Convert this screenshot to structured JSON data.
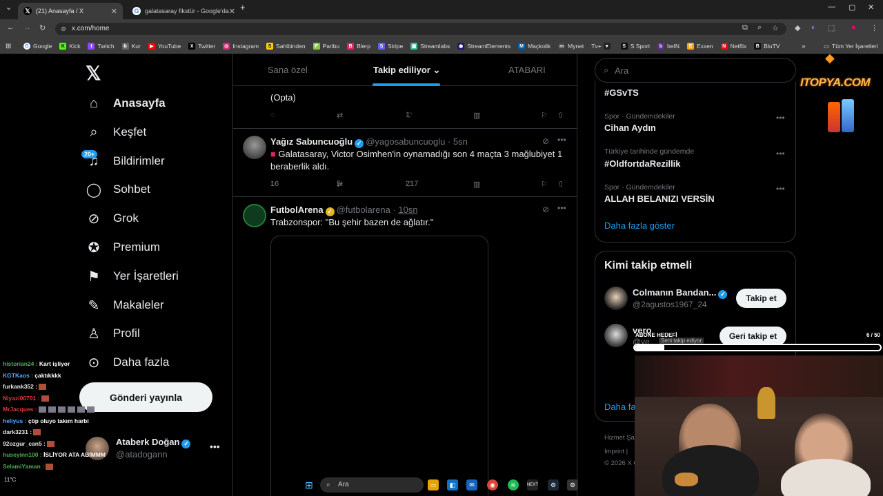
{
  "browser": {
    "tabs": [
      {
        "label": "(21) Anasayfa / X",
        "active": true
      },
      {
        "label": "galatasaray fikstür - Google'da",
        "active": false
      }
    ],
    "url": "x.com/home",
    "bookmarks": [
      "Google",
      "Kick",
      "Twitch",
      "Kur",
      "YouTube",
      "Twitter",
      "Instagram",
      "Sahibinden",
      "Paribu",
      "Blerp",
      "Stripe",
      "Streamlabs",
      "StreamElements",
      "Maçkolik",
      "Mynet",
      "Tv+",
      "S Sport",
      "beIN",
      "Exxen",
      "Netflix",
      "BluTV"
    ],
    "all_bookmarks": "Tüm Yer İşaretleri"
  },
  "nav": {
    "home": "Anasayfa",
    "explore": "Keşfet",
    "notifications": "Bildirimler",
    "notifications_badge": "20+",
    "messages": "Sohbet",
    "grok": "Grok",
    "premium": "Premium",
    "bookmarks": "Yer İşaretleri",
    "articles": "Makaleler",
    "profile": "Profil",
    "more": "Daha fazla",
    "post_button": "Gönderi yayınla"
  },
  "account": {
    "name": "Ataberk Doğan",
    "handle": "@atadogann"
  },
  "feed": {
    "tabs": [
      "Sana özel",
      "Takip ediliyor",
      "ATABARI"
    ],
    "partial_tweet": {
      "text": "(Opta)",
      "likes": "1"
    },
    "tweets": [
      {
        "name": "Yağız Sabuncuoğlu",
        "handle": "@yagosabuncuoglu",
        "time": "5sn",
        "text_line1": "Galatasaray, Victor Osimhen'in oynamadığı son 4 maçta 3 mağlubiyet 1",
        "text_line2": "beraberlik aldı.",
        "replies": "16",
        "retweets": "5",
        "likes": "217"
      },
      {
        "name": "FutbolArena",
        "handle": "@futbolarena",
        "time": "10sn",
        "text": "Trabzonspor: \"Bu şehir bazen de ağlatır.\""
      }
    ]
  },
  "sidebar": {
    "search_placeholder": "Ara",
    "trends": [
      {
        "category": "",
        "name": "#GSvTS"
      },
      {
        "category": "Spor · Gündemdekiler",
        "name": "Cihan Aydın"
      },
      {
        "category": "Türkiye tarihinde gündemde",
        "name": "#OldfortdaRezillik"
      },
      {
        "category": "Spor · Gündemdekiler",
        "name": "ALLAH BELANIZI VERSİN"
      }
    ],
    "show_more": "Daha fazla göster",
    "who_to_follow": {
      "title": "Kimi takip etmeli",
      "suggestions": [
        {
          "name": "Colmanın Bandan...",
          "handle": "@2agustos1967_24",
          "button": "Takip et"
        },
        {
          "name": "vero",
          "handle": "@ve",
          "button": "Geri takip et",
          "follows_you": "Seni takip ediyor"
        }
      ],
      "more": "Daha fa"
    },
    "footer": [
      "Hizmet Şar",
      "Imprint  |",
      "© 2026 X C"
    ]
  },
  "stream_overlay": {
    "chat": [
      {
        "user": "historian24",
        "msg": "Kart işliyor",
        "color": "#4caf50"
      },
      {
        "user": "KGTKaos",
        "msg": "çaktıkkkk",
        "color": "#5aa8ff"
      },
      {
        "user": "furkank352",
        "msg": "",
        "color": "#e8e8e8",
        "emotes": 1
      },
      {
        "user": "Niyazi00701",
        "msg": "",
        "color": "#e03a3a",
        "emotes": 1
      },
      {
        "user": "MrJacques",
        "msg": "",
        "color": "#e03a3a",
        "emotes": 6
      },
      {
        "user": "heliyus",
        "msg": "çöp oluyo takım harbi",
        "color": "#5aa8ff"
      },
      {
        "user": "dark3231",
        "msg": "",
        "color": "#e8e8e8",
        "emotes": 1
      },
      {
        "user": "92ozgur_can5",
        "msg": "",
        "color": "#e8e8e8",
        "emotes": 1
      },
      {
        "user": "huseyinn100",
        "msg": "İSLİYOR ATA ABİMMM",
        "color": "#4caf50"
      },
      {
        "user": "SelamiYaman",
        "msg": "",
        "color": "#4caf50",
        "emotes": 1
      }
    ],
    "sub_goal": {
      "label": "ABONE HEDEFİ",
      "count": "6 / 50",
      "progress": 0.12
    },
    "brand": "ITOPYA.COM"
  },
  "taskbar": {
    "search": "Ara",
    "weather": "11°C"
  }
}
